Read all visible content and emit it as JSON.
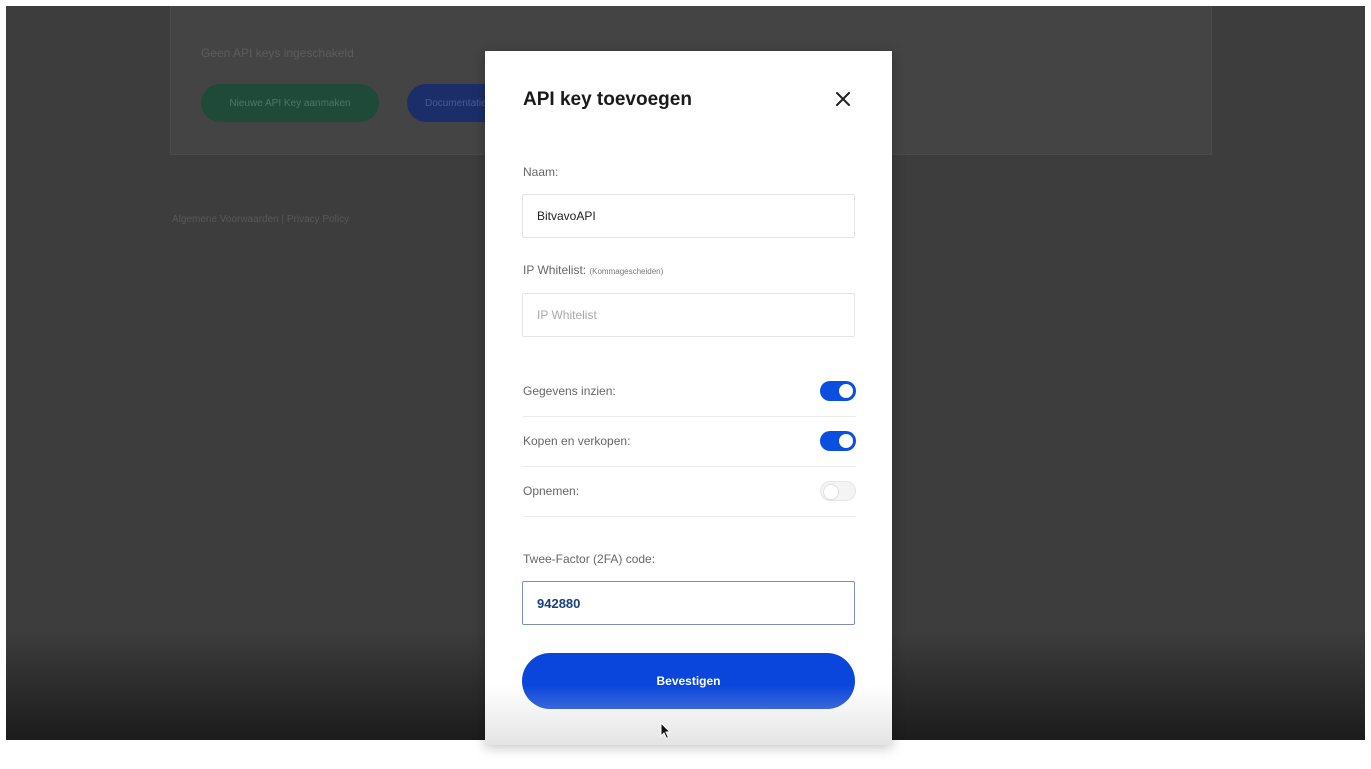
{
  "background": {
    "card_title": "Geen API keys ingeschakeld",
    "add_key_button": "Nieuwe API Key aanmaken",
    "docs_button": "Documentatie",
    "footer_links": "Algemene Voorwaarden | Privacy Policy"
  },
  "modal": {
    "title": "API key toevoegen",
    "close_icon": "close-icon",
    "name": {
      "label": "Naam:",
      "value": "BitvavoAPI"
    },
    "ip_whitelist": {
      "label": "IP Whitelist:",
      "hint": "(Kommagescheiden)",
      "placeholder": "IP Whitelist",
      "value": ""
    },
    "permissions": [
      {
        "label": "Gegevens inzien:",
        "enabled": true
      },
      {
        "label": "Kopen en verkopen:",
        "enabled": true
      },
      {
        "label": "Opnemen:",
        "enabled": false
      }
    ],
    "twofa": {
      "label": "Twee-Factor (2FA) code:",
      "value": "942880"
    },
    "confirm_button": "Bevestigen"
  },
  "colors": {
    "accent": "#0a46dc",
    "toggle_on": "#0a4fe0",
    "overlay": "#3d3d3d"
  }
}
